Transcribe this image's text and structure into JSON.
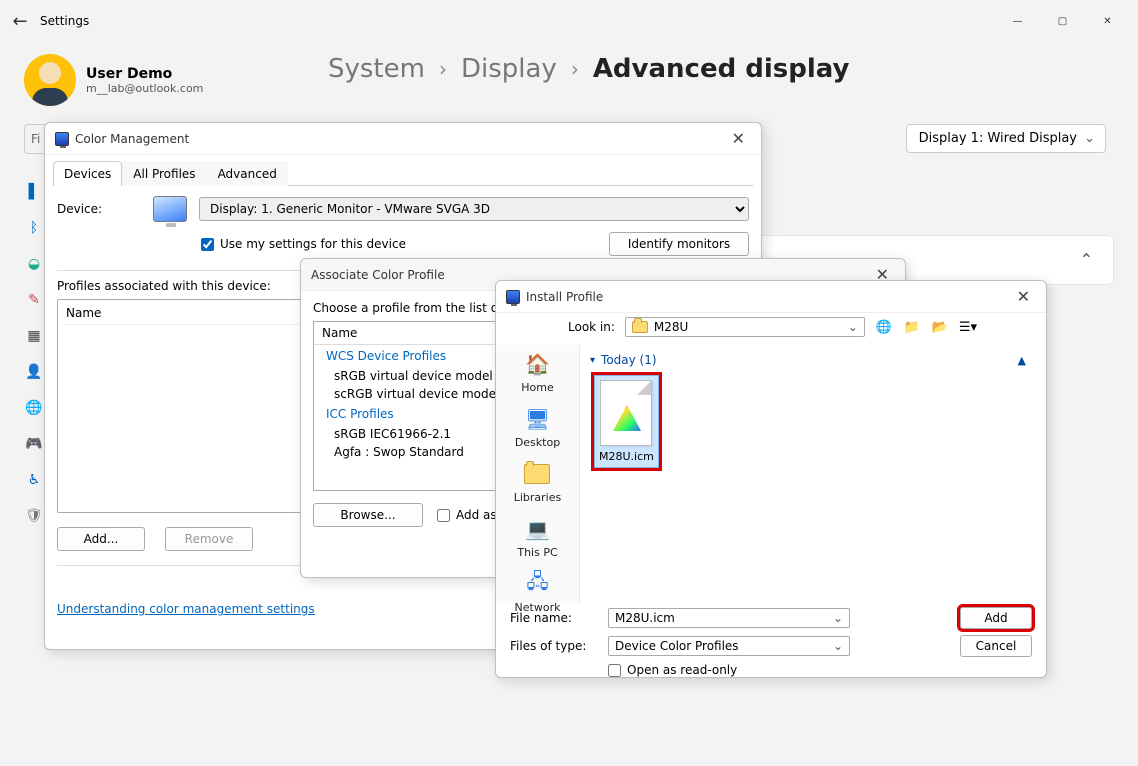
{
  "titlebar": {
    "title": "Settings"
  },
  "user": {
    "name": "User Demo",
    "email": "m__lab@outlook.com"
  },
  "search": {
    "stub": "Fi"
  },
  "breadcrumb": {
    "a": "System",
    "b": "Display",
    "c": "Advanced display"
  },
  "display_selector": {
    "label": "Display 1: Wired Display"
  },
  "color_mgmt": {
    "title": "Color Management",
    "tabs": {
      "devices": "Devices",
      "all": "All Profiles",
      "adv": "Advanced"
    },
    "device_label": "Device:",
    "device_value": "Display: 1. Generic Monitor - VMware SVGA 3D",
    "use_my_settings": "Use my settings for this device",
    "identify": "Identify monitors",
    "assoc_label": "Profiles associated with this device:",
    "col_name": "Name",
    "add": "Add...",
    "remove": "Remove",
    "link": "Understanding color management settings"
  },
  "assoc": {
    "title": "Associate Color Profile",
    "prompt": "Choose a profile from the list of p",
    "col_name": "Name",
    "grp1": "WCS Device Profiles",
    "i1": "sRGB virtual device model profil",
    "i2": "scRGB virtual device model prof",
    "grp2": "ICC Profiles",
    "i3": "sRGB IEC61966-2.1",
    "i4": "Agfa : Swop Standard",
    "browse": "Browse...",
    "add_as": "Add as"
  },
  "install": {
    "title": "Install Profile",
    "look_in_label": "Look in:",
    "look_in_value": "M28U",
    "side": {
      "home": "Home",
      "desktop": "Desktop",
      "libraries": "Libraries",
      "thispc": "This PC",
      "network": "Network"
    },
    "group": "Today (1)",
    "file": "M28U.icm",
    "file_name_label": "File name:",
    "file_name_value": "M28U.icm",
    "file_type_label": "Files of type:",
    "file_type_value": "Device Color Profiles",
    "open_readonly": "Open as read-only",
    "add": "Add",
    "cancel": "Cancel"
  }
}
